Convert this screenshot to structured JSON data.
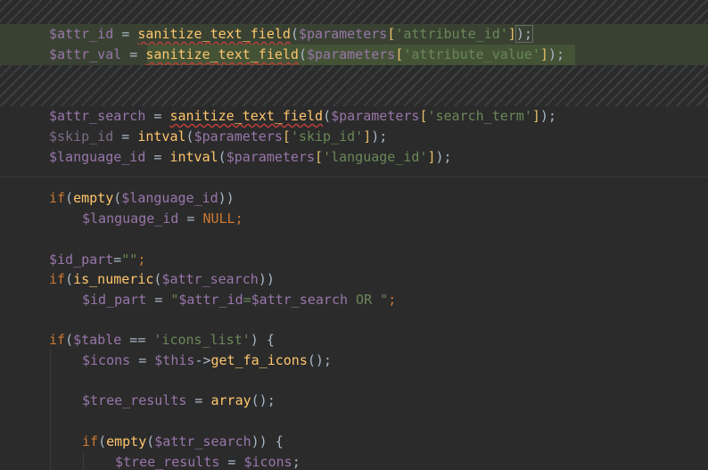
{
  "editor": {
    "lines": [
      {
        "id": "attr_id",
        "var": "$attr_id",
        "eq": " = ",
        "fn": "sanitize_text_field",
        "arg": "$parameters",
        "key": "'attribute_id'",
        "end": ");"
      },
      {
        "id": "attr_val",
        "var": "$attr_val",
        "eq": " = ",
        "fn": "sanitize_text_field",
        "arg": "$parameters",
        "key": "'attribute_value'",
        "end": ");"
      },
      {
        "id": "attr_search",
        "var": "$attr_search",
        "eq": " = ",
        "fn": "sanitize_text_field",
        "arg": "$parameters",
        "key": "'search_term'",
        "end": ");"
      },
      {
        "id": "skip_id",
        "var": "$skip_id",
        "eq": " = ",
        "fn": "intval",
        "arg": "$parameters",
        "key": "'skip_id'",
        "end": ");"
      },
      {
        "id": "language_id",
        "var": "$language_id",
        "eq": " = ",
        "fn": "intval",
        "arg": "$parameters",
        "key": "'language_id'",
        "end": ");"
      }
    ],
    "if1": {
      "kw": "if",
      "fn": "empty",
      "var": "$language_id"
    },
    "if1_body": {
      "var": "$language_id",
      "eq": " = ",
      "val": "NULL",
      "end": ";"
    },
    "id_part": {
      "var": "$id_part",
      "eq": "=",
      "str": "\"\"",
      "end": ";"
    },
    "if2": {
      "kw": "if",
      "fn": "is_numeric",
      "var": "$attr_search"
    },
    "if2_body": {
      "var": "$id_part",
      "eq": " = ",
      "str1": "\"",
      "v1": "$attr_id",
      "mid": "=",
      "v2": "$attr_search",
      "str2": " OR \"",
      "end": ";"
    },
    "if3": {
      "kw": "if",
      "var": "$table",
      "op": " == ",
      "str": "'icons_list'",
      "end": ") {"
    },
    "icons": {
      "var": "$icons",
      "eq": " = ",
      "this": "$this",
      "arrow": "->",
      "fn": "get_fa_icons",
      "end": "();"
    },
    "tree": {
      "var": "$tree_results",
      "eq": " = ",
      "fn": "array",
      "end": "();"
    },
    "if4": {
      "kw": "if",
      "fn": "empty",
      "var": "$attr_search",
      "end": ")) {"
    },
    "if4_body": {
      "var": "$tree_results",
      "eq": " = ",
      "val": "$icons",
      "end": ";"
    }
  }
}
